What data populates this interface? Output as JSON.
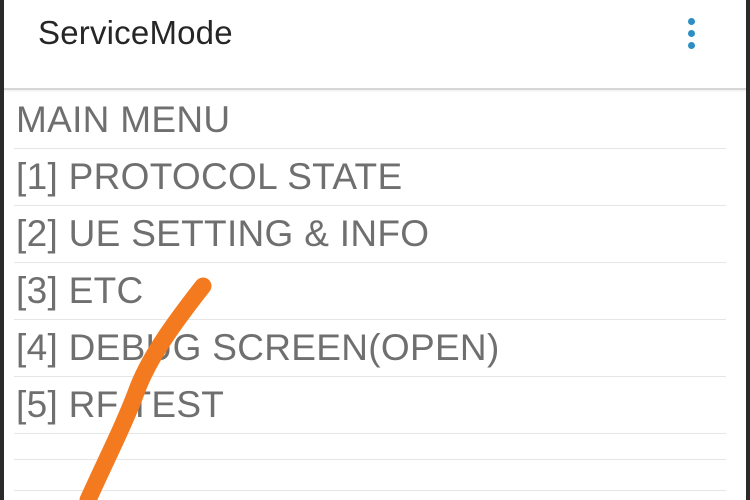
{
  "app_bar": {
    "title": "ServiceMode",
    "overflow_icon": "more-vert-icon",
    "accent_color": "#2d8ec4"
  },
  "menu": {
    "heading": "MAIN MENU",
    "items": [
      {
        "label": "[1] PROTOCOL STATE"
      },
      {
        "label": "[2] UE SETTING & INFO"
      },
      {
        "label": "[3] ETC"
      },
      {
        "label": "[4] DEBUG SCREEN(OPEN)"
      },
      {
        "label": "[5] RF TEST"
      }
    ]
  },
  "annotation": {
    "color": "#f47a1f"
  }
}
